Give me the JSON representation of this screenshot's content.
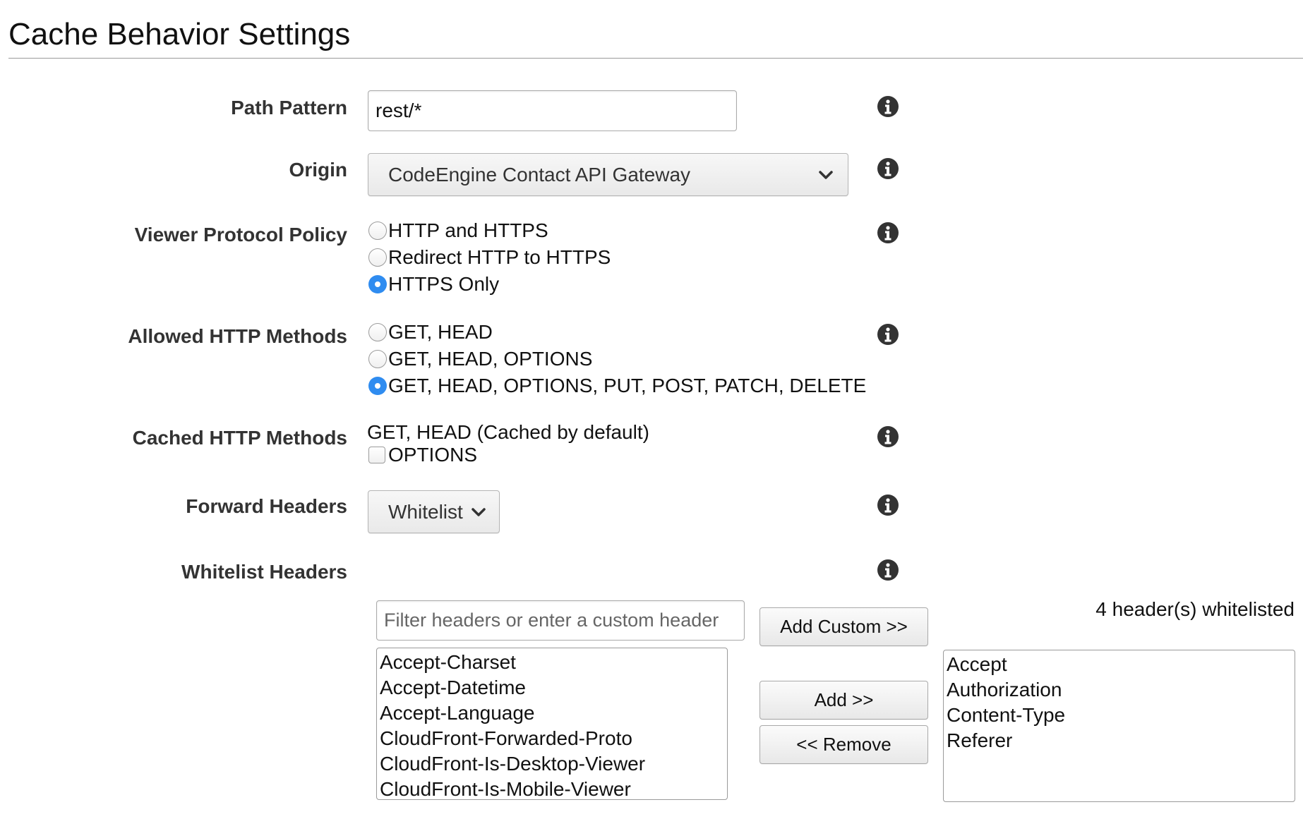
{
  "page": {
    "title": "Cache Behavior Settings"
  },
  "path_pattern": {
    "label": "Path Pattern",
    "value": "rest/*",
    "info_icon": "info-icon"
  },
  "origin": {
    "label": "Origin",
    "selected": "CodeEngine Contact API Gateway",
    "info_icon": "info-icon"
  },
  "viewer_protocol_policy": {
    "label": "Viewer Protocol Policy",
    "options": [
      {
        "label": "HTTP and HTTPS",
        "checked": false
      },
      {
        "label": "Redirect HTTP to HTTPS",
        "checked": false
      },
      {
        "label": "HTTPS Only",
        "checked": true
      }
    ]
  },
  "allowed_http_methods": {
    "label": "Allowed HTTP Methods",
    "options": [
      {
        "label": "GET, HEAD",
        "checked": false
      },
      {
        "label": "GET, HEAD, OPTIONS",
        "checked": false
      },
      {
        "label": "GET, HEAD, OPTIONS, PUT, POST, PATCH, DELETE",
        "checked": true
      }
    ]
  },
  "cached_http_methods": {
    "label": "Cached HTTP Methods",
    "default_text": "GET, HEAD (Cached by default)",
    "options_checkbox_label": "OPTIONS",
    "options_checked": false
  },
  "forward_headers": {
    "label": "Forward Headers",
    "selected": "Whitelist"
  },
  "whitelist_headers": {
    "label": "Whitelist Headers",
    "filter_placeholder": "Filter headers or enter a custom header",
    "available": [
      "Accept-Charset",
      "Accept-Datetime",
      "Accept-Language",
      "CloudFront-Forwarded-Proto",
      "CloudFront-Is-Desktop-Viewer",
      "CloudFront-Is-Mobile-Viewer"
    ],
    "whitelisted_count_text": "4 header(s) whitelisted",
    "whitelisted": [
      "Accept",
      "Authorization",
      "Content-Type",
      "Referer"
    ],
    "add_custom_label": "Add Custom >>",
    "add_label": "Add >>",
    "remove_label": "<< Remove"
  },
  "colors": {
    "radio_checked": "#2f8cf0",
    "label_text": "#333333",
    "info_icon": "#333333"
  }
}
